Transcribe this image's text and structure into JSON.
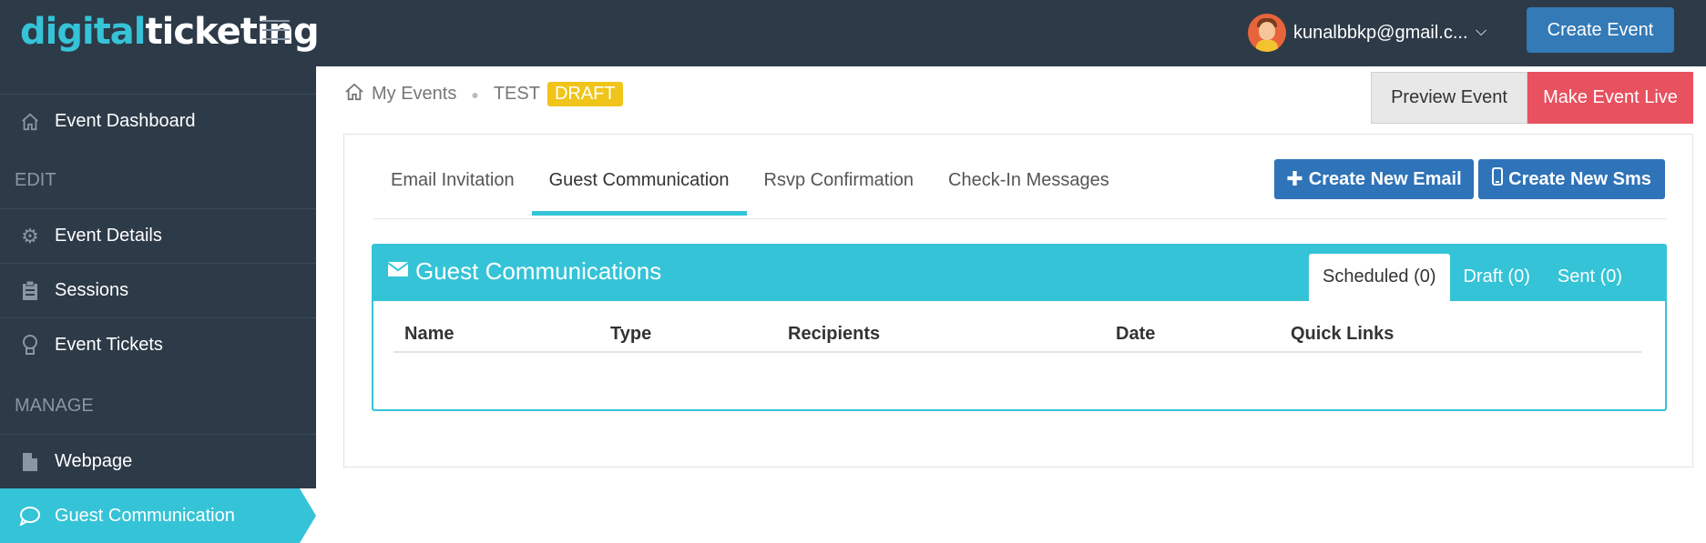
{
  "app": {
    "logo_part1": "digital",
    "logo_part2": "ticketing"
  },
  "topbar": {
    "user_email": "kunalbbkp@gmail.c...",
    "create_event_label": "Create Event"
  },
  "sidebar": {
    "items": [
      {
        "label": "Event Dashboard",
        "icon": "home-icon"
      },
      {
        "label": "Event Details",
        "icon": "gear-icon"
      },
      {
        "label": "Sessions",
        "icon": "clipboard-icon"
      },
      {
        "label": "Event Tickets",
        "icon": "lightbulb-icon"
      },
      {
        "label": "Webpage",
        "icon": "file-icon"
      },
      {
        "label": "Guest Communication",
        "icon": "chat-bubble-icon"
      }
    ],
    "headings": {
      "edit": "EDIT",
      "manage": "MANAGE"
    }
  },
  "breadcrumb": {
    "root": "My Events",
    "event_name": "TEST",
    "status": "DRAFT"
  },
  "actions": {
    "preview_label": "Preview Event",
    "live_label": "Make Event Live"
  },
  "tabs": [
    {
      "label": "Email Invitation"
    },
    {
      "label": "Guest Communication"
    },
    {
      "label": "Rsvp Confirmation"
    },
    {
      "label": "Check-In Messages"
    }
  ],
  "buttons": {
    "create_email": "Create New Email",
    "create_sms": "Create New Sms"
  },
  "communications": {
    "title": "Guest Communications",
    "tabs": [
      {
        "label": "Scheduled (0)"
      },
      {
        "label": "Draft (0)"
      },
      {
        "label": "Sent (0)"
      }
    ],
    "columns": [
      "Name",
      "Type",
      "Recipients",
      "Date",
      "Quick Links"
    ]
  },
  "colors": {
    "topbar_bg": "#2d3a48",
    "accent": "#35c3d7",
    "primary": "#337ab7",
    "danger": "#e8515f",
    "draft_badge": "#f0c419"
  }
}
